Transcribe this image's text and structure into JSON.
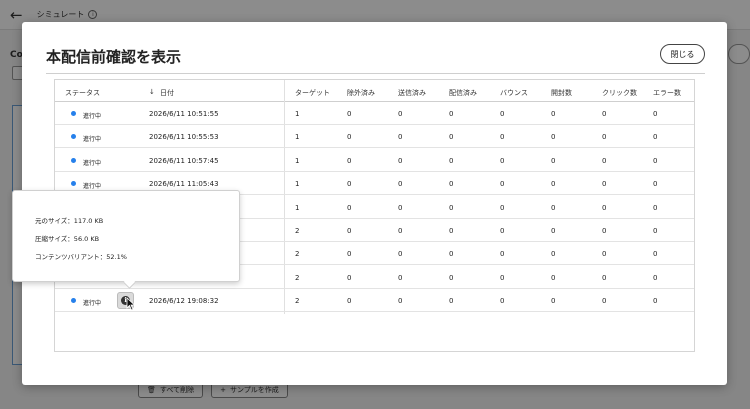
{
  "app": {
    "back_icon": "arrow-left-icon",
    "title": "シミュレート",
    "left_label": "Co",
    "bottom_buttons": [
      "すべて削除",
      "サンプルを作成"
    ]
  },
  "modal": {
    "title": "本配信前確認を表示",
    "close_label": "閉じる"
  },
  "table": {
    "sort_icon": "arrow-down-icon",
    "headers": [
      "ステータス",
      "日付",
      "ターゲット",
      "除外済み",
      "送信済み",
      "配信済み",
      "バウンス",
      "開封数",
      "クリック数",
      "エラー数"
    ],
    "rows": [
      {
        "status": "進行中",
        "date": "2026/6/11 10:51:55",
        "target": "1",
        "excluded": "0",
        "sent": "0",
        "delivered": "0",
        "bounce": "0",
        "opens": "0",
        "clicks": "0",
        "errors": "0"
      },
      {
        "status": "進行中",
        "date": "2026/6/11 10:55:53",
        "target": "1",
        "excluded": "0",
        "sent": "0",
        "delivered": "0",
        "bounce": "0",
        "opens": "0",
        "clicks": "0",
        "errors": "0"
      },
      {
        "status": "進行中",
        "date": "2026/6/11 10:57:45",
        "target": "1",
        "excluded": "0",
        "sent": "0",
        "delivered": "0",
        "bounce": "0",
        "opens": "0",
        "clicks": "0",
        "errors": "0"
      },
      {
        "status": "進行中",
        "date": "2026/6/11 11:05:43",
        "target": "1",
        "excluded": "0",
        "sent": "0",
        "delivered": "0",
        "bounce": "0",
        "opens": "0",
        "clicks": "0",
        "errors": "0"
      },
      {
        "status": "",
        "date": "",
        "target": "1",
        "excluded": "0",
        "sent": "0",
        "delivered": "0",
        "bounce": "0",
        "opens": "0",
        "clicks": "0",
        "errors": "0"
      },
      {
        "status": "",
        "date": "",
        "target": "2",
        "excluded": "0",
        "sent": "0",
        "delivered": "0",
        "bounce": "0",
        "opens": "0",
        "clicks": "0",
        "errors": "0"
      },
      {
        "status": "",
        "date": "",
        "target": "2",
        "excluded": "0",
        "sent": "0",
        "delivered": "0",
        "bounce": "0",
        "opens": "0",
        "clicks": "0",
        "errors": "0"
      },
      {
        "status": "",
        "date": "",
        "target": "2",
        "excluded": "0",
        "sent": "0",
        "delivered": "0",
        "bounce": "0",
        "opens": "0",
        "clicks": "0",
        "errors": "0"
      },
      {
        "status": "進行中",
        "date": "2026/6/12 19:08:32",
        "target": "2",
        "excluded": "0",
        "sent": "0",
        "delivered": "0",
        "bounce": "0",
        "opens": "0",
        "clicks": "0",
        "errors": "0"
      }
    ]
  },
  "popover": {
    "original_size": "元のサイズ：117.0 KB",
    "compressed_size": "圧縮サイズ：56.0 KB",
    "content_variant": "コンテンツバリアント：52.1%"
  },
  "colors": {
    "status_dot": "#2680eb",
    "overlay": "rgba(0,0,0,0.45)"
  }
}
